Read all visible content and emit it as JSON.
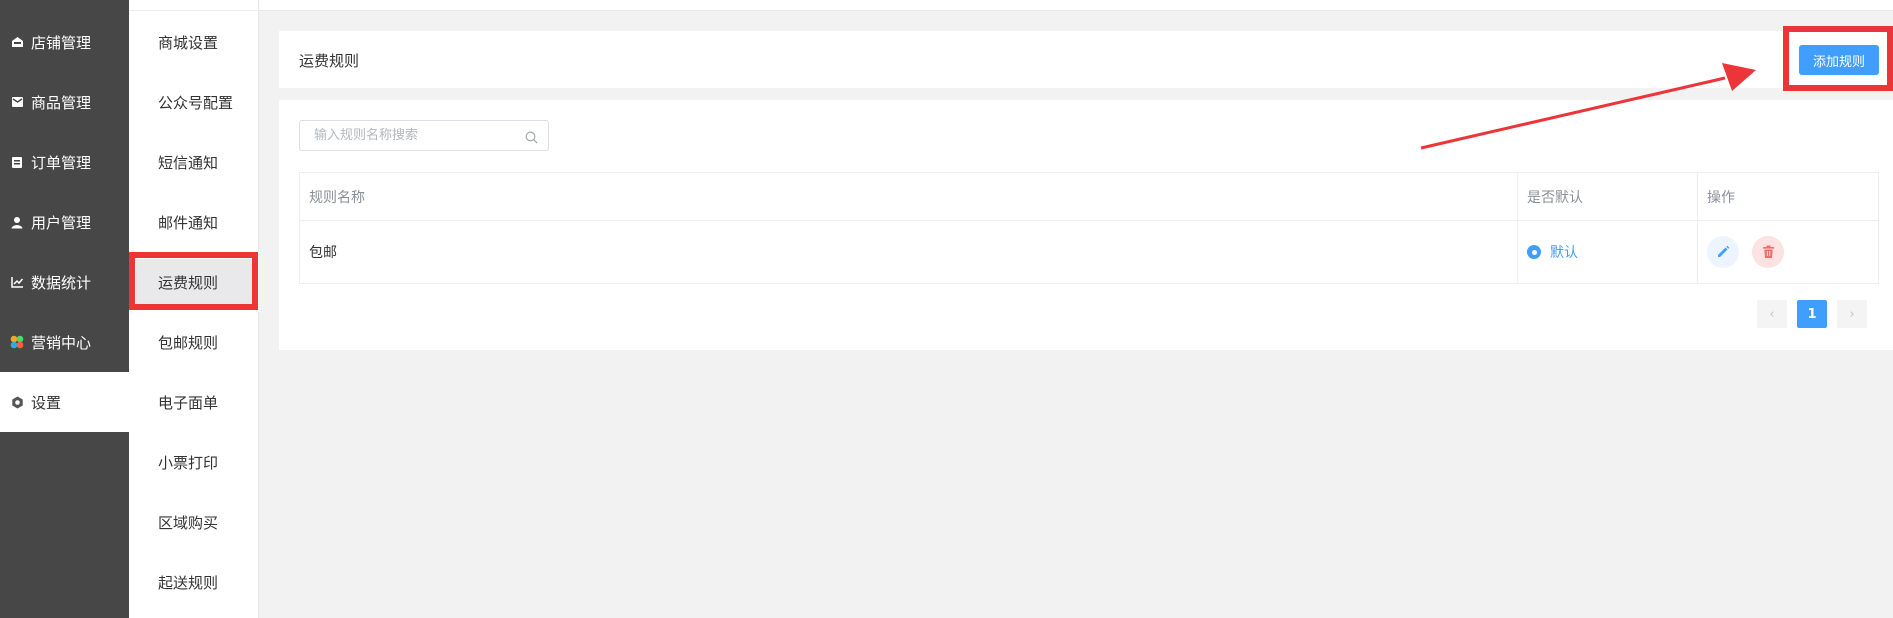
{
  "sidebar_primary": {
    "items": [
      {
        "label": "店铺管理",
        "icon": "store-icon"
      },
      {
        "label": "商品管理",
        "icon": "product-icon"
      },
      {
        "label": "订单管理",
        "icon": "order-icon"
      },
      {
        "label": "用户管理",
        "icon": "user-icon"
      },
      {
        "label": "数据统计",
        "icon": "chart-icon"
      },
      {
        "label": "营销中心",
        "icon": "marketing-icon"
      },
      {
        "label": "设置",
        "icon": "gear-icon",
        "active": true
      }
    ]
  },
  "sidebar_secondary": {
    "items": [
      {
        "label": "商城设置"
      },
      {
        "label": "公众号配置"
      },
      {
        "label": "短信通知"
      },
      {
        "label": "邮件通知"
      },
      {
        "label": "运费规则",
        "active": true
      },
      {
        "label": "包邮规则"
      },
      {
        "label": "电子面单"
      },
      {
        "label": "小票打印"
      },
      {
        "label": "区域购买"
      },
      {
        "label": "起送规则"
      }
    ]
  },
  "header": {
    "title": "运费规则",
    "add_button": "添加规则"
  },
  "search": {
    "placeholder": "输入规则名称搜索"
  },
  "table": {
    "columns": [
      "规则名称",
      "是否默认",
      "操作"
    ],
    "rows": [
      {
        "name": "包邮",
        "default_label": "默认"
      }
    ]
  },
  "pagination": {
    "prev": "‹",
    "current": "1",
    "next": "›"
  },
  "colors": {
    "primary": "#409eff",
    "sidebar_dark": "#474747",
    "highlight_red": "#ec3539",
    "delete_red": "#f56c6c"
  }
}
